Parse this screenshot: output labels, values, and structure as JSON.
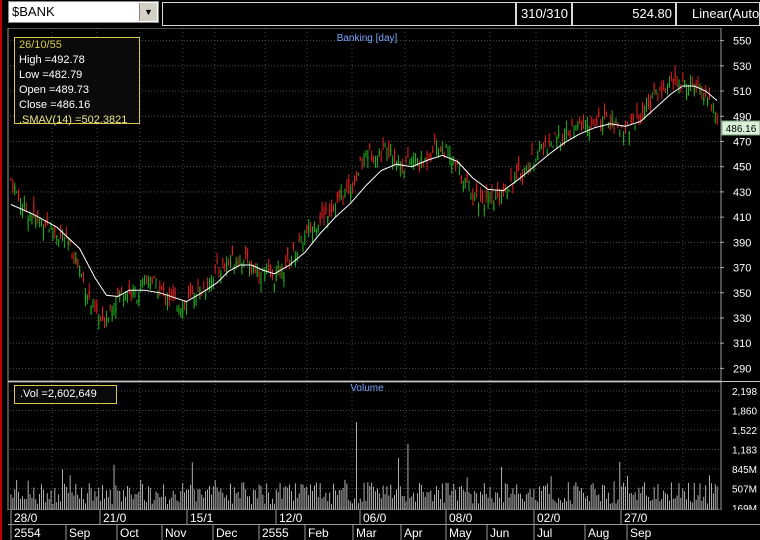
{
  "toolbar": {
    "symbol": "$BANK",
    "bar_count": "310/310",
    "last_price": "524.80",
    "scale_mode": "Linear(Auto"
  },
  "price_panel": {
    "title": "Banking [day]",
    "current_label": "486.16",
    "info": {
      "date": "26/10/55",
      "high": "High  =492.78",
      "low": "Low   =482.79",
      "open": "Open  =489.73",
      "close": "Close  =486.16",
      "smav": ".SMAV(14)   =502.3821"
    }
  },
  "volume_panel": {
    "title": "Volume",
    "info": ".Vol   =2,602,649"
  },
  "x_labels_top": [
    "28/0",
    "21/0",
    "15/1",
    "12/0",
    "06/0",
    "08/0",
    "02/0",
    "27/0"
  ],
  "x_labels_bottom": [
    "2554",
    "Sep",
    "Oct",
    "Nov",
    "Dec",
    "2555",
    "Feb",
    "Mar",
    "Apr",
    "May",
    "Jun",
    "Jul",
    "Aug",
    "Sep"
  ],
  "colors": {
    "up": "#22b022",
    "down": "#e02020",
    "sma": "#ffffff",
    "grid": "#4a4a4a",
    "volume": "#d8d8d8",
    "info_border": "#d6c84e"
  },
  "chart_data": {
    "type": "candlestick",
    "title": "Banking [day]",
    "ylim": [
      280,
      560
    ],
    "y_ticks": [
      290,
      310,
      330,
      350,
      370,
      390,
      410,
      430,
      450,
      470,
      490,
      510,
      530,
      550
    ],
    "close_series": [
      [
        0,
        440
      ],
      [
        6,
        418
      ],
      [
        12,
        410
      ],
      [
        18,
        405
      ],
      [
        24,
        398
      ],
      [
        30,
        388
      ],
      [
        36,
        370
      ],
      [
        42,
        340
      ],
      [
        48,
        325
      ],
      [
        54,
        345
      ],
      [
        60,
        352
      ],
      [
        66,
        348
      ],
      [
        72,
        362
      ],
      [
        78,
        352
      ],
      [
        84,
        345
      ],
      [
        90,
        340
      ],
      [
        96,
        348
      ],
      [
        102,
        355
      ],
      [
        108,
        368
      ],
      [
        114,
        375
      ],
      [
        120,
        378
      ],
      [
        126,
        372
      ],
      [
        132,
        365
      ],
      [
        138,
        362
      ],
      [
        144,
        372
      ],
      [
        150,
        385
      ],
      [
        156,
        398
      ],
      [
        162,
        410
      ],
      [
        168,
        418
      ],
      [
        174,
        428
      ],
      [
        180,
        438
      ],
      [
        186,
        462
      ],
      [
        192,
        458
      ],
      [
        198,
        468
      ],
      [
        204,
        450
      ],
      [
        210,
        455
      ],
      [
        216,
        452
      ],
      [
        222,
        468
      ],
      [
        228,
        462
      ],
      [
        234,
        448
      ],
      [
        240,
        432
      ],
      [
        246,
        425
      ],
      [
        252,
        420
      ],
      [
        258,
        432
      ],
      [
        264,
        440
      ],
      [
        270,
        448
      ],
      [
        276,
        462
      ],
      [
        282,
        468
      ],
      [
        288,
        472
      ],
      [
        294,
        478
      ],
      [
        300,
        484
      ],
      [
        306,
        482
      ],
      [
        312,
        488
      ],
      [
        318,
        480
      ],
      [
        324,
        482
      ],
      [
        330,
        490
      ],
      [
        336,
        505
      ],
      [
        342,
        512
      ],
      [
        348,
        518
      ],
      [
        354,
        515
      ],
      [
        360,
        512
      ],
      [
        366,
        505
      ],
      [
        370,
        486
      ]
    ],
    "sma_series": [
      [
        0,
        420
      ],
      [
        12,
        412
      ],
      [
        24,
        402
      ],
      [
        36,
        385
      ],
      [
        44,
        362
      ],
      [
        50,
        348
      ],
      [
        56,
        347
      ],
      [
        62,
        352
      ],
      [
        70,
        352
      ],
      [
        78,
        350
      ],
      [
        86,
        346
      ],
      [
        92,
        343
      ],
      [
        100,
        350
      ],
      [
        108,
        358
      ],
      [
        114,
        367
      ],
      [
        120,
        372
      ],
      [
        126,
        372
      ],
      [
        132,
        368
      ],
      [
        138,
        365
      ],
      [
        146,
        372
      ],
      [
        154,
        382
      ],
      [
        162,
        397
      ],
      [
        170,
        410
      ],
      [
        178,
        421
      ],
      [
        186,
        435
      ],
      [
        194,
        447
      ],
      [
        202,
        452
      ],
      [
        210,
        450
      ],
      [
        218,
        455
      ],
      [
        226,
        459
      ],
      [
        234,
        454
      ],
      [
        242,
        441
      ],
      [
        250,
        432
      ],
      [
        258,
        431
      ],
      [
        266,
        440
      ],
      [
        274,
        450
      ],
      [
        282,
        460
      ],
      [
        290,
        469
      ],
      [
        298,
        476
      ],
      [
        306,
        481
      ],
      [
        314,
        484
      ],
      [
        322,
        482
      ],
      [
        330,
        486
      ],
      [
        338,
        497
      ],
      [
        346,
        508
      ],
      [
        352,
        514
      ],
      [
        358,
        514
      ],
      [
        364,
        510
      ],
      [
        370,
        502.3821
      ]
    ],
    "last": {
      "date": "26/10/55",
      "high": 492.78,
      "low": 482.79,
      "open": 489.73,
      "close": 486.16,
      "smav14": 502.3821
    },
    "volume": {
      "y_ticks": [
        "2,198",
        "1,860",
        "1,522",
        "1,183",
        "845M",
        "507M",
        "169M"
      ],
      "last": 2602649
    }
  }
}
